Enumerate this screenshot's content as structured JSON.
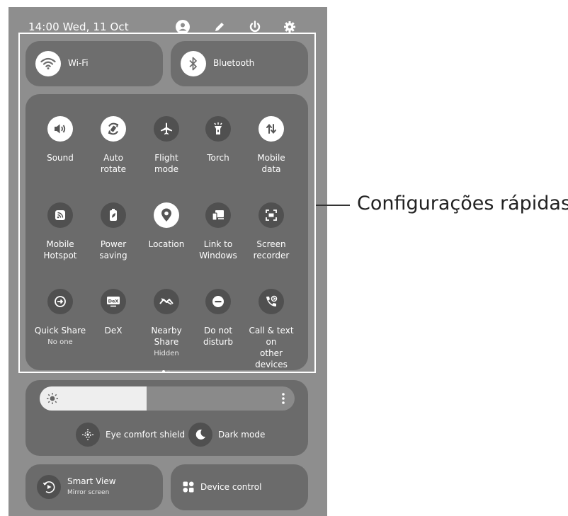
{
  "status_bar": {
    "time_date": "14:00  Wed, 11 Oct"
  },
  "top_toggles": [
    {
      "label": "Wi-Fi",
      "icon": "wifi-icon",
      "on": true
    },
    {
      "label": "Bluetooth",
      "icon": "bluetooth-icon",
      "on": true
    }
  ],
  "tiles": [
    {
      "label": "Sound",
      "sub": "",
      "icon": "sound-icon",
      "on": true
    },
    {
      "label": "Auto\nrotate",
      "sub": "",
      "icon": "auto-rotate-icon",
      "on": true
    },
    {
      "label": "Flight\nmode",
      "sub": "",
      "icon": "airplane-icon",
      "on": false
    },
    {
      "label": "Torch",
      "sub": "",
      "icon": "torch-icon",
      "on": false
    },
    {
      "label": "Mobile\ndata",
      "sub": "",
      "icon": "mobile-data-icon",
      "on": true
    },
    {
      "label": "Mobile\nHotspot",
      "sub": "",
      "icon": "hotspot-icon",
      "on": false
    },
    {
      "label": "Power\nsaving",
      "sub": "",
      "icon": "battery-icon",
      "on": false
    },
    {
      "label": "Location",
      "sub": "",
      "icon": "location-icon",
      "on": true
    },
    {
      "label": "Link to\nWindows",
      "sub": "",
      "icon": "link-to-windows-icon",
      "on": false
    },
    {
      "label": "Screen\nrecorder",
      "sub": "",
      "icon": "screen-recorder-icon",
      "on": false
    },
    {
      "label": "Quick Share",
      "sub": "No one",
      "icon": "quick-share-icon",
      "on": false
    },
    {
      "label": "DeX",
      "sub": "",
      "icon": "dex-icon",
      "on": false
    },
    {
      "label": "Nearby Share",
      "sub": "Hidden",
      "icon": "nearby-share-icon",
      "on": false
    },
    {
      "label": "Do not\ndisturb",
      "sub": "",
      "icon": "do-not-disturb-icon",
      "on": false
    },
    {
      "label": "Call & text on\nother devices",
      "sub": "",
      "icon": "call-text-icon",
      "on": false
    }
  ],
  "brightness": {
    "level": 0.42
  },
  "eye_comfort": {
    "label": "Eye comfort shield"
  },
  "dark_mode": {
    "label": "Dark mode"
  },
  "smart_view": {
    "label": "Smart View",
    "sub": "Mirror screen"
  },
  "device_control": {
    "label": "Device control"
  },
  "callout": {
    "text": "Configurações rápidas"
  },
  "colors": {
    "panel_bg": "#8e8e8e",
    "tile_bg": "#6b6b6b",
    "active": "#ffffff",
    "inactive": "#505050"
  }
}
